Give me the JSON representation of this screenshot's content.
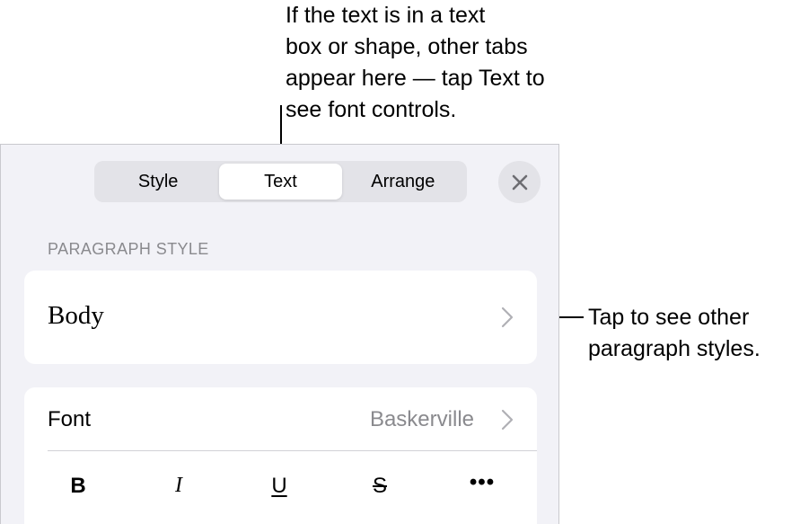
{
  "callouts": {
    "top": "If the text is in a text\nbox or shape, other tabs\nappear here — tap Text to\nsee font controls.",
    "right": "Tap to see other\nparagraph styles."
  },
  "tabs": [
    {
      "label": "Style",
      "active": false
    },
    {
      "label": "Text",
      "active": true
    },
    {
      "label": "Arrange",
      "active": false
    }
  ],
  "paragraph_style": {
    "header": "PARAGRAPH STYLE",
    "current": "Body"
  },
  "font": {
    "label": "Font",
    "value": "Baskerville"
  },
  "format_buttons": {
    "bold": "B",
    "italic": "I",
    "underline": "U",
    "strikethrough": "S",
    "more": "•••"
  },
  "colors": {
    "panel_bg": "#f2f2f7",
    "card_bg": "#ffffff",
    "secondary_text": "#8a8a8e",
    "icon_gray": "#8e8e93"
  },
  "icons": {
    "close": "close-icon",
    "chevron": "chevron-right-icon"
  }
}
